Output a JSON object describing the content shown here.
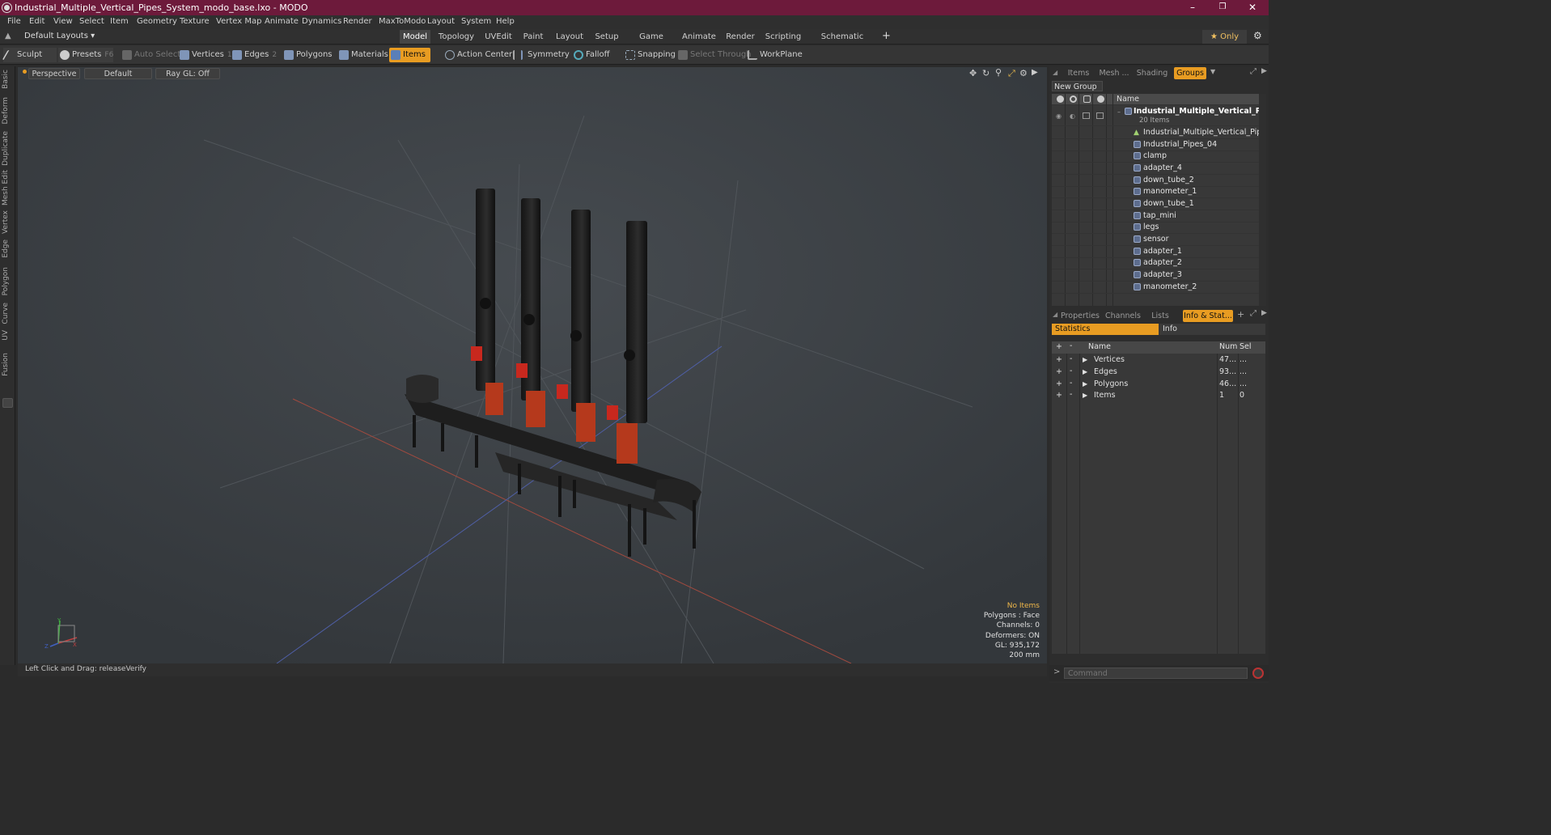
{
  "titlebar": {
    "title": "Industrial_Multiple_Vertical_Pipes_System_modo_base.lxo - MODO",
    "minimize": "–",
    "maximize": "❐",
    "close": "✕"
  },
  "menu": [
    "File",
    "Edit",
    "View",
    "Select",
    "Item",
    "Geometry",
    "Texture",
    "Vertex Map",
    "Animate",
    "Dynamics",
    "Render",
    "MaxToModo",
    "Layout",
    "System",
    "Help"
  ],
  "layoutbar": {
    "layout_label": "Default Layouts ▾",
    "tabs": [
      "Model",
      "Topology",
      "UVEdit",
      "Paint",
      "Layout",
      "Setup",
      "Game Tools",
      "Animate",
      "Render",
      "Scripting",
      "Schematic Fusion"
    ],
    "add": "+",
    "only_label": "★ Only",
    "gear": "⚙"
  },
  "toolbar": {
    "sculpt": "Sculpt",
    "presets": "Presets",
    "presets_key": "F6",
    "auto_select": "Auto Select",
    "vertices": "Vertices",
    "vertices_key": "1",
    "edges": "Edges",
    "edges_key": "2",
    "polygons": "Polygons",
    "materials": "Materials",
    "items": "Items",
    "action_center": "Action Center",
    "symmetry": "Symmetry",
    "falloff": "Falloff",
    "snapping": "Snapping",
    "select_through": "Select Through",
    "workplane": "WorkPlane"
  },
  "left_tabs": [
    "Basic",
    "Deform",
    "Duplicate",
    "Mesh Edit",
    "Vertex",
    "Edge",
    "Polygon",
    "Curve",
    "UV",
    "Fusion"
  ],
  "viewport": {
    "perspective": "Perspective",
    "default": "Default",
    "raygl": "Ray GL: Off",
    "info": {
      "selection": "No Items",
      "polygons": "Polygons : Face",
      "channels": "Channels: 0",
      "deformers": "Deformers: ON",
      "gl": "GL: 935,172",
      "size": "200 mm"
    }
  },
  "statusbar": {
    "text": "Left Click and Drag:  releaseVerify"
  },
  "items_panel": {
    "tabs": [
      "Items",
      "Mesh ...",
      "Shading",
      "Groups"
    ],
    "new_group": "New Group",
    "name_col": "Name",
    "group_name": "Industrial_Multiple_Vertical_P...",
    "group_count": "20 Items",
    "children": [
      "Industrial_Multiple_Vertical_Pipes ...",
      "Industrial_Pipes_04",
      "clamp",
      "adapter_4",
      "down_tube_2",
      "manometer_1",
      "down_tube_1",
      "tap_mini",
      "legs",
      "sensor",
      "adapter_1",
      "adapter_2",
      "adapter_3",
      "manometer_2"
    ]
  },
  "stats_panel": {
    "tabs": [
      "Properties",
      "Channels",
      "Lists",
      "Info & Stat..."
    ],
    "subtabs": [
      "Statistics",
      "Info"
    ],
    "headers": {
      "name": "Name",
      "num": "Num",
      "sel": "Sel"
    },
    "rows": [
      {
        "name": "Vertices",
        "num": "47...",
        "sel": "..."
      },
      {
        "name": "Edges",
        "num": "93...",
        "sel": "..."
      },
      {
        "name": "Polygons",
        "num": "46...",
        "sel": "..."
      },
      {
        "name": "Items",
        "num": "1",
        "sel": "0"
      }
    ]
  },
  "command": {
    "prompt": ">",
    "placeholder": "Command"
  },
  "colors": {
    "titlebar": "#6d1a3b",
    "accent": "#e89c22",
    "viewport": "#3b3f43"
  }
}
